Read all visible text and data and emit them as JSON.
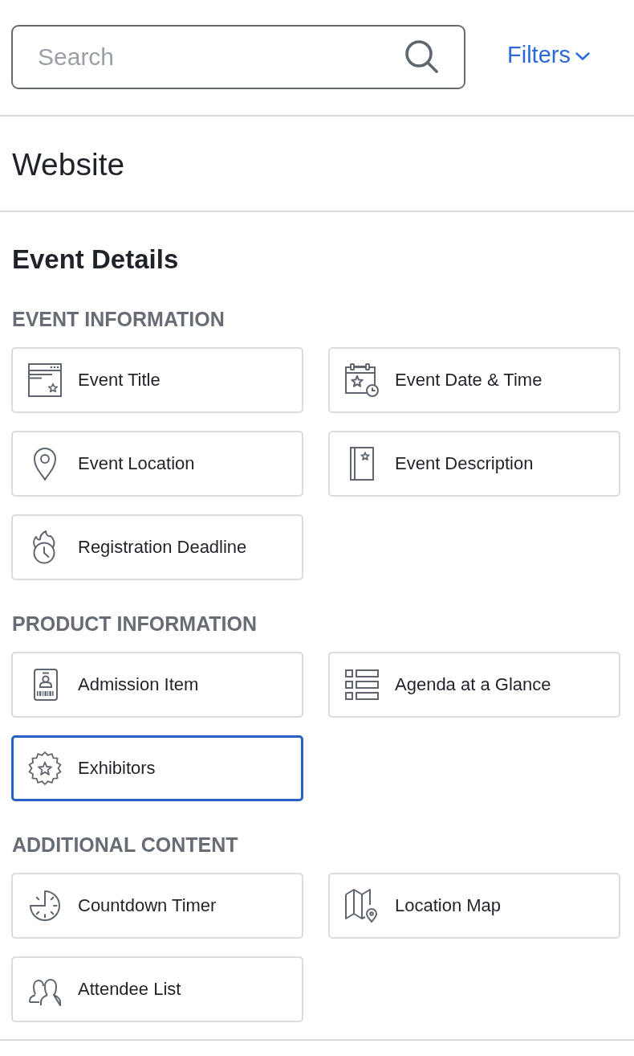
{
  "search": {
    "placeholder": "Search"
  },
  "filters": {
    "label": "Filters"
  },
  "page_title": "Website",
  "heading": "Event Details",
  "sections": [
    {
      "title": "EVENT INFORMATION",
      "items": [
        {
          "label": "Event Title",
          "selected": false
        },
        {
          "label": "Event Date & Time",
          "selected": false
        },
        {
          "label": "Event Location",
          "selected": false
        },
        {
          "label": "Event Description",
          "selected": false
        },
        {
          "label": "Registration Deadline",
          "selected": false
        }
      ]
    },
    {
      "title": "PRODUCT INFORMATION",
      "items": [
        {
          "label": "Admission Item",
          "selected": false
        },
        {
          "label": "Agenda at a Glance",
          "selected": false
        },
        {
          "label": "Exhibitors",
          "selected": true
        }
      ]
    },
    {
      "title": "ADDITIONAL CONTENT",
      "items": [
        {
          "label": "Countdown Timer",
          "selected": false
        },
        {
          "label": "Location Map",
          "selected": false
        },
        {
          "label": "Attendee List",
          "selected": false
        }
      ]
    }
  ]
}
